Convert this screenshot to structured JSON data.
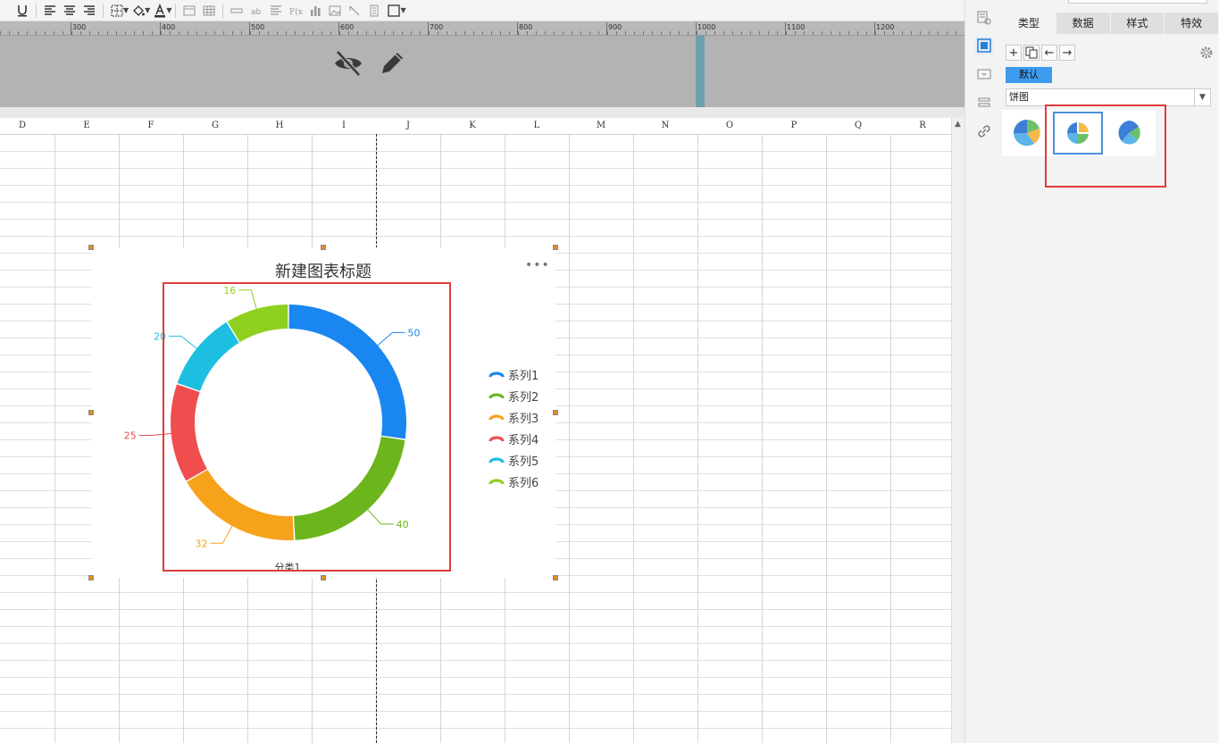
{
  "ruler": {
    "marks": [
      "300",
      "400",
      "500",
      "600",
      "700",
      "800",
      "900",
      "1000",
      "1100",
      "1200"
    ]
  },
  "columns": [
    "D",
    "E",
    "F",
    "G",
    "H",
    "I",
    "J",
    "K",
    "L",
    "M",
    "N",
    "O",
    "P",
    "Q",
    "R"
  ],
  "chart": {
    "menu_label": "•••",
    "highlight_color": "#e23b3b"
  },
  "chart_data": {
    "type": "pie",
    "variant": "donut",
    "title": "新建图表标题",
    "category_label": "分类1",
    "series": [
      {
        "name": "系列1",
        "value": 50,
        "color": "#1a86f0"
      },
      {
        "name": "系列2",
        "value": 40,
        "color": "#6db51c"
      },
      {
        "name": "系列3",
        "value": 32,
        "color": "#f7a21b"
      },
      {
        "name": "系列4",
        "value": 25,
        "color": "#f04d4f"
      },
      {
        "name": "系列5",
        "value": 20,
        "color": "#1dbfe0"
      },
      {
        "name": "系列6",
        "value": 16,
        "color": "#8fd01f"
      }
    ],
    "legend_position": "right"
  },
  "panel": {
    "tabs": [
      "类型",
      "数据",
      "样式",
      "特效"
    ],
    "active_tab": "类型",
    "default_button": "默认",
    "chart_type_value": "饼图",
    "thumbnails": [
      "pie-thumb-icon",
      "donut-thumb-icon",
      "rose-thumb-icon"
    ]
  },
  "colors": {
    "accent": "#3d9bf0",
    "selection": "#4a90d9"
  }
}
